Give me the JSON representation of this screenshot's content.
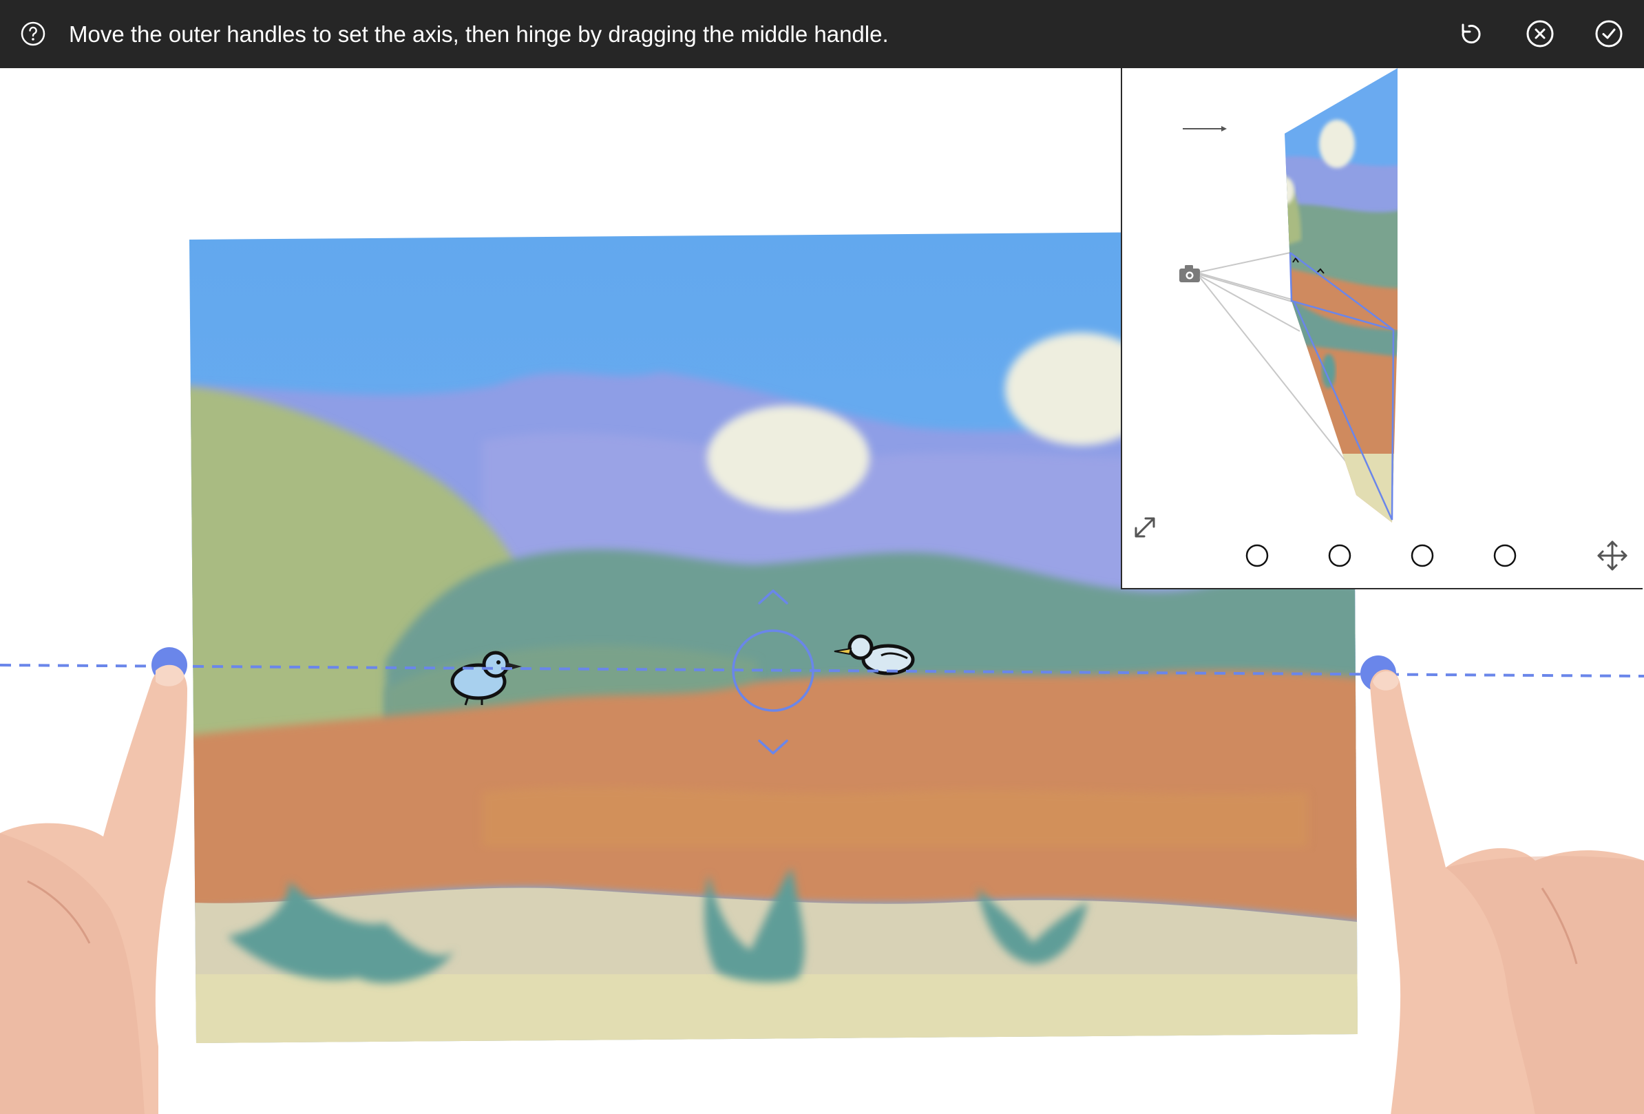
{
  "toolbar": {
    "instruction": "Move the outer handles to set the axis, then hinge by dragging the middle handle.",
    "icons": {
      "help": "question-circle-icon",
      "reset": "rotate-ccw-icon",
      "cancel": "x-circle-icon",
      "confirm": "check-circle-icon"
    }
  },
  "preview": {
    "icons": {
      "direction": "arrow-right-icon",
      "camera": "camera-icon",
      "expand": "expand-diagonal-icon",
      "move": "move-arrows-icon"
    },
    "presets_count_visible": 4
  },
  "colors": {
    "toolbar_bg": "#262626",
    "handle": "#6a86ea",
    "axis_line": "#6a86ea",
    "sky": "#66aaf0",
    "ground": "#cf8a5e"
  }
}
